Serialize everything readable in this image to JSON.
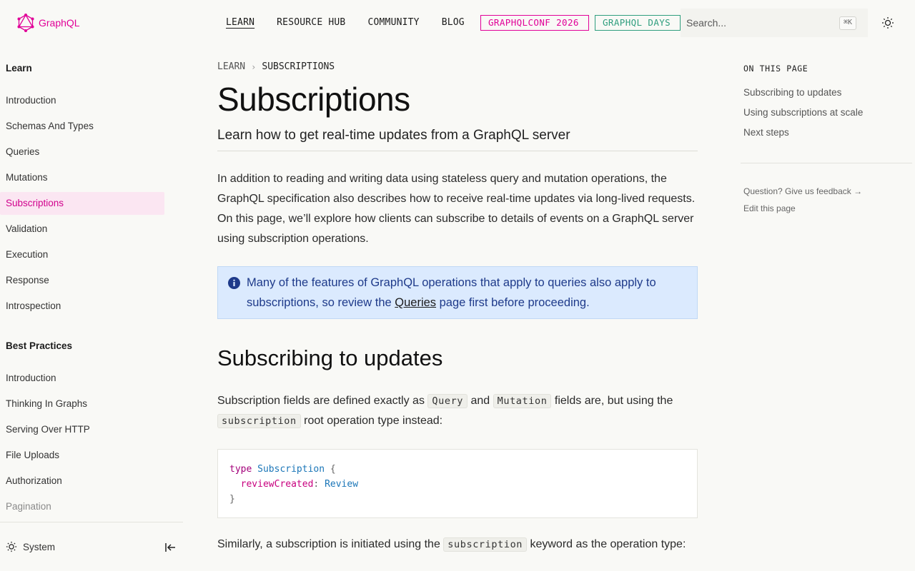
{
  "header": {
    "logo_text": "GraphQL",
    "nav": [
      "LEARN",
      "RESOURCE HUB",
      "COMMUNITY",
      "BLOG"
    ],
    "pill_conf": "GRAPHQLCONF 2026",
    "pill_days": "GRAPHQL DAYS",
    "search_placeholder": "Search...",
    "search_shortcut": "⌘K",
    "theme_icon": "sun-icon"
  },
  "sidebar": {
    "section1": "Learn",
    "learn_items": [
      "Introduction",
      "Schemas And Types",
      "Queries",
      "Mutations",
      "Subscriptions",
      "Validation",
      "Execution",
      "Response",
      "Introspection"
    ],
    "section2": "Best Practices",
    "best_items": [
      "Introduction",
      "Thinking In Graphs",
      "Serving Over HTTP",
      "File Uploads",
      "Authorization",
      "Pagination"
    ],
    "theme_label": "System"
  },
  "main": {
    "crumb1": "LEARN",
    "crumb2": "SUBSCRIPTIONS",
    "title": "Subscriptions",
    "subtitle": "Learn how to get real-time updates from a GraphQL server",
    "intro": "In addition to reading and writing data using stateless query and mutation operations, the GraphQL specification also describes how to receive real-time updates via long-lived requests. On this page, we’ll explore how clients can subscribe to details of events on a GraphQL server using subscription operations.",
    "callout_pre": "Many of the features of GraphQL operations that apply to queries also apply to subscriptions, so review the ",
    "callout_link": "Queries",
    "callout_post": " page first before proceeding.",
    "h2": "Subscribing to updates",
    "p2_a": "Subscription fields are defined exactly as ",
    "p2_code1": "Query",
    "p2_b": " and ",
    "p2_code2": "Mutation",
    "p2_c": " fields are, but using the ",
    "p2_code3": "subscription",
    "p2_d": " root operation type instead:",
    "code_kw": "type",
    "code_type": "Subscription",
    "code_open": " {",
    "code_field": "reviewCreated",
    "code_colon": ": ",
    "code_ftype": "Review",
    "code_close": "}",
    "p3_a": "Similarly, a subscription is initiated using the ",
    "p3_code": "subscription",
    "p3_b": " keyword as the operation type:"
  },
  "toc": {
    "heading": "ON THIS PAGE",
    "items": [
      "Subscribing to updates",
      "Using subscriptions at scale",
      "Next steps"
    ],
    "feedback": "Question? Give us feedback →",
    "edit": "Edit this page"
  }
}
